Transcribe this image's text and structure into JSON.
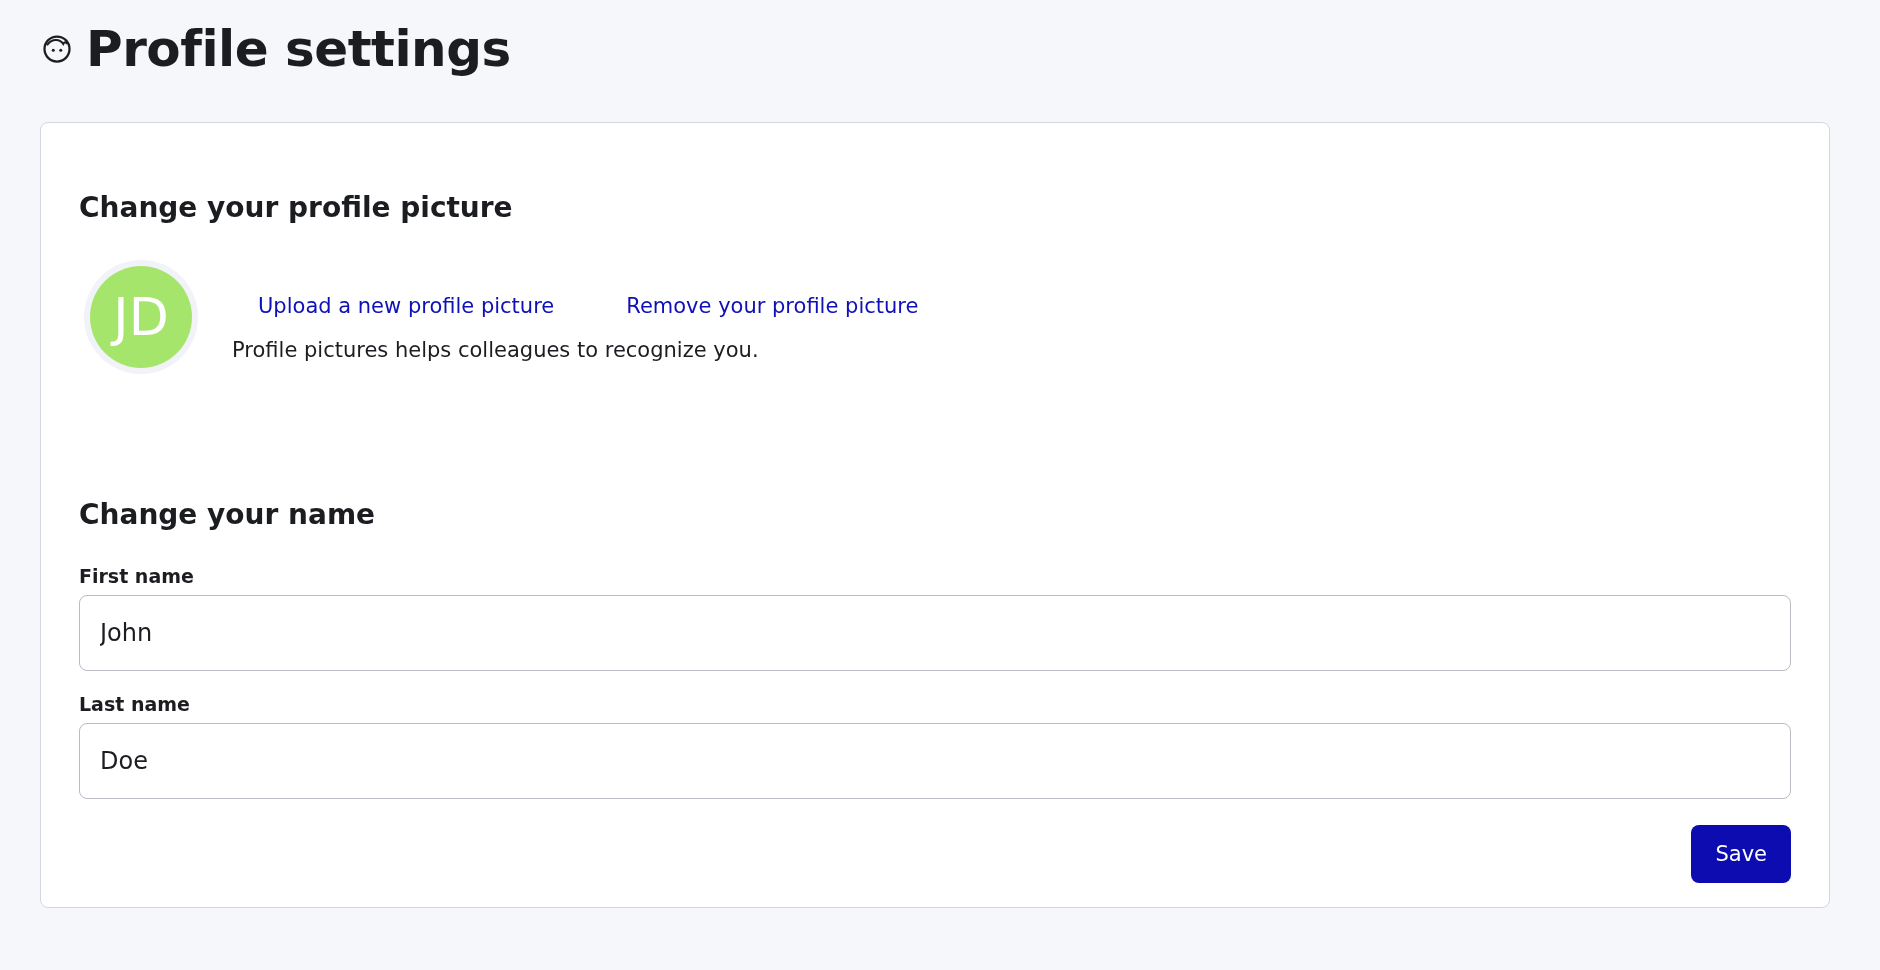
{
  "page_title": "Profile settings",
  "picture_section": {
    "heading": "Change your profile picture",
    "avatar_initials": "JD",
    "links": [
      "Upload a new profile picture",
      "Remove your profile picture"
    ],
    "description": "Profile pictures helps colleagues to recognize you."
  },
  "name_section": {
    "heading": "Change your name",
    "fields": [
      {
        "label": "First name",
        "value": "John"
      },
      {
        "label": "Last name",
        "value": "Doe"
      }
    ]
  },
  "buttons": [
    "Save"
  ]
}
